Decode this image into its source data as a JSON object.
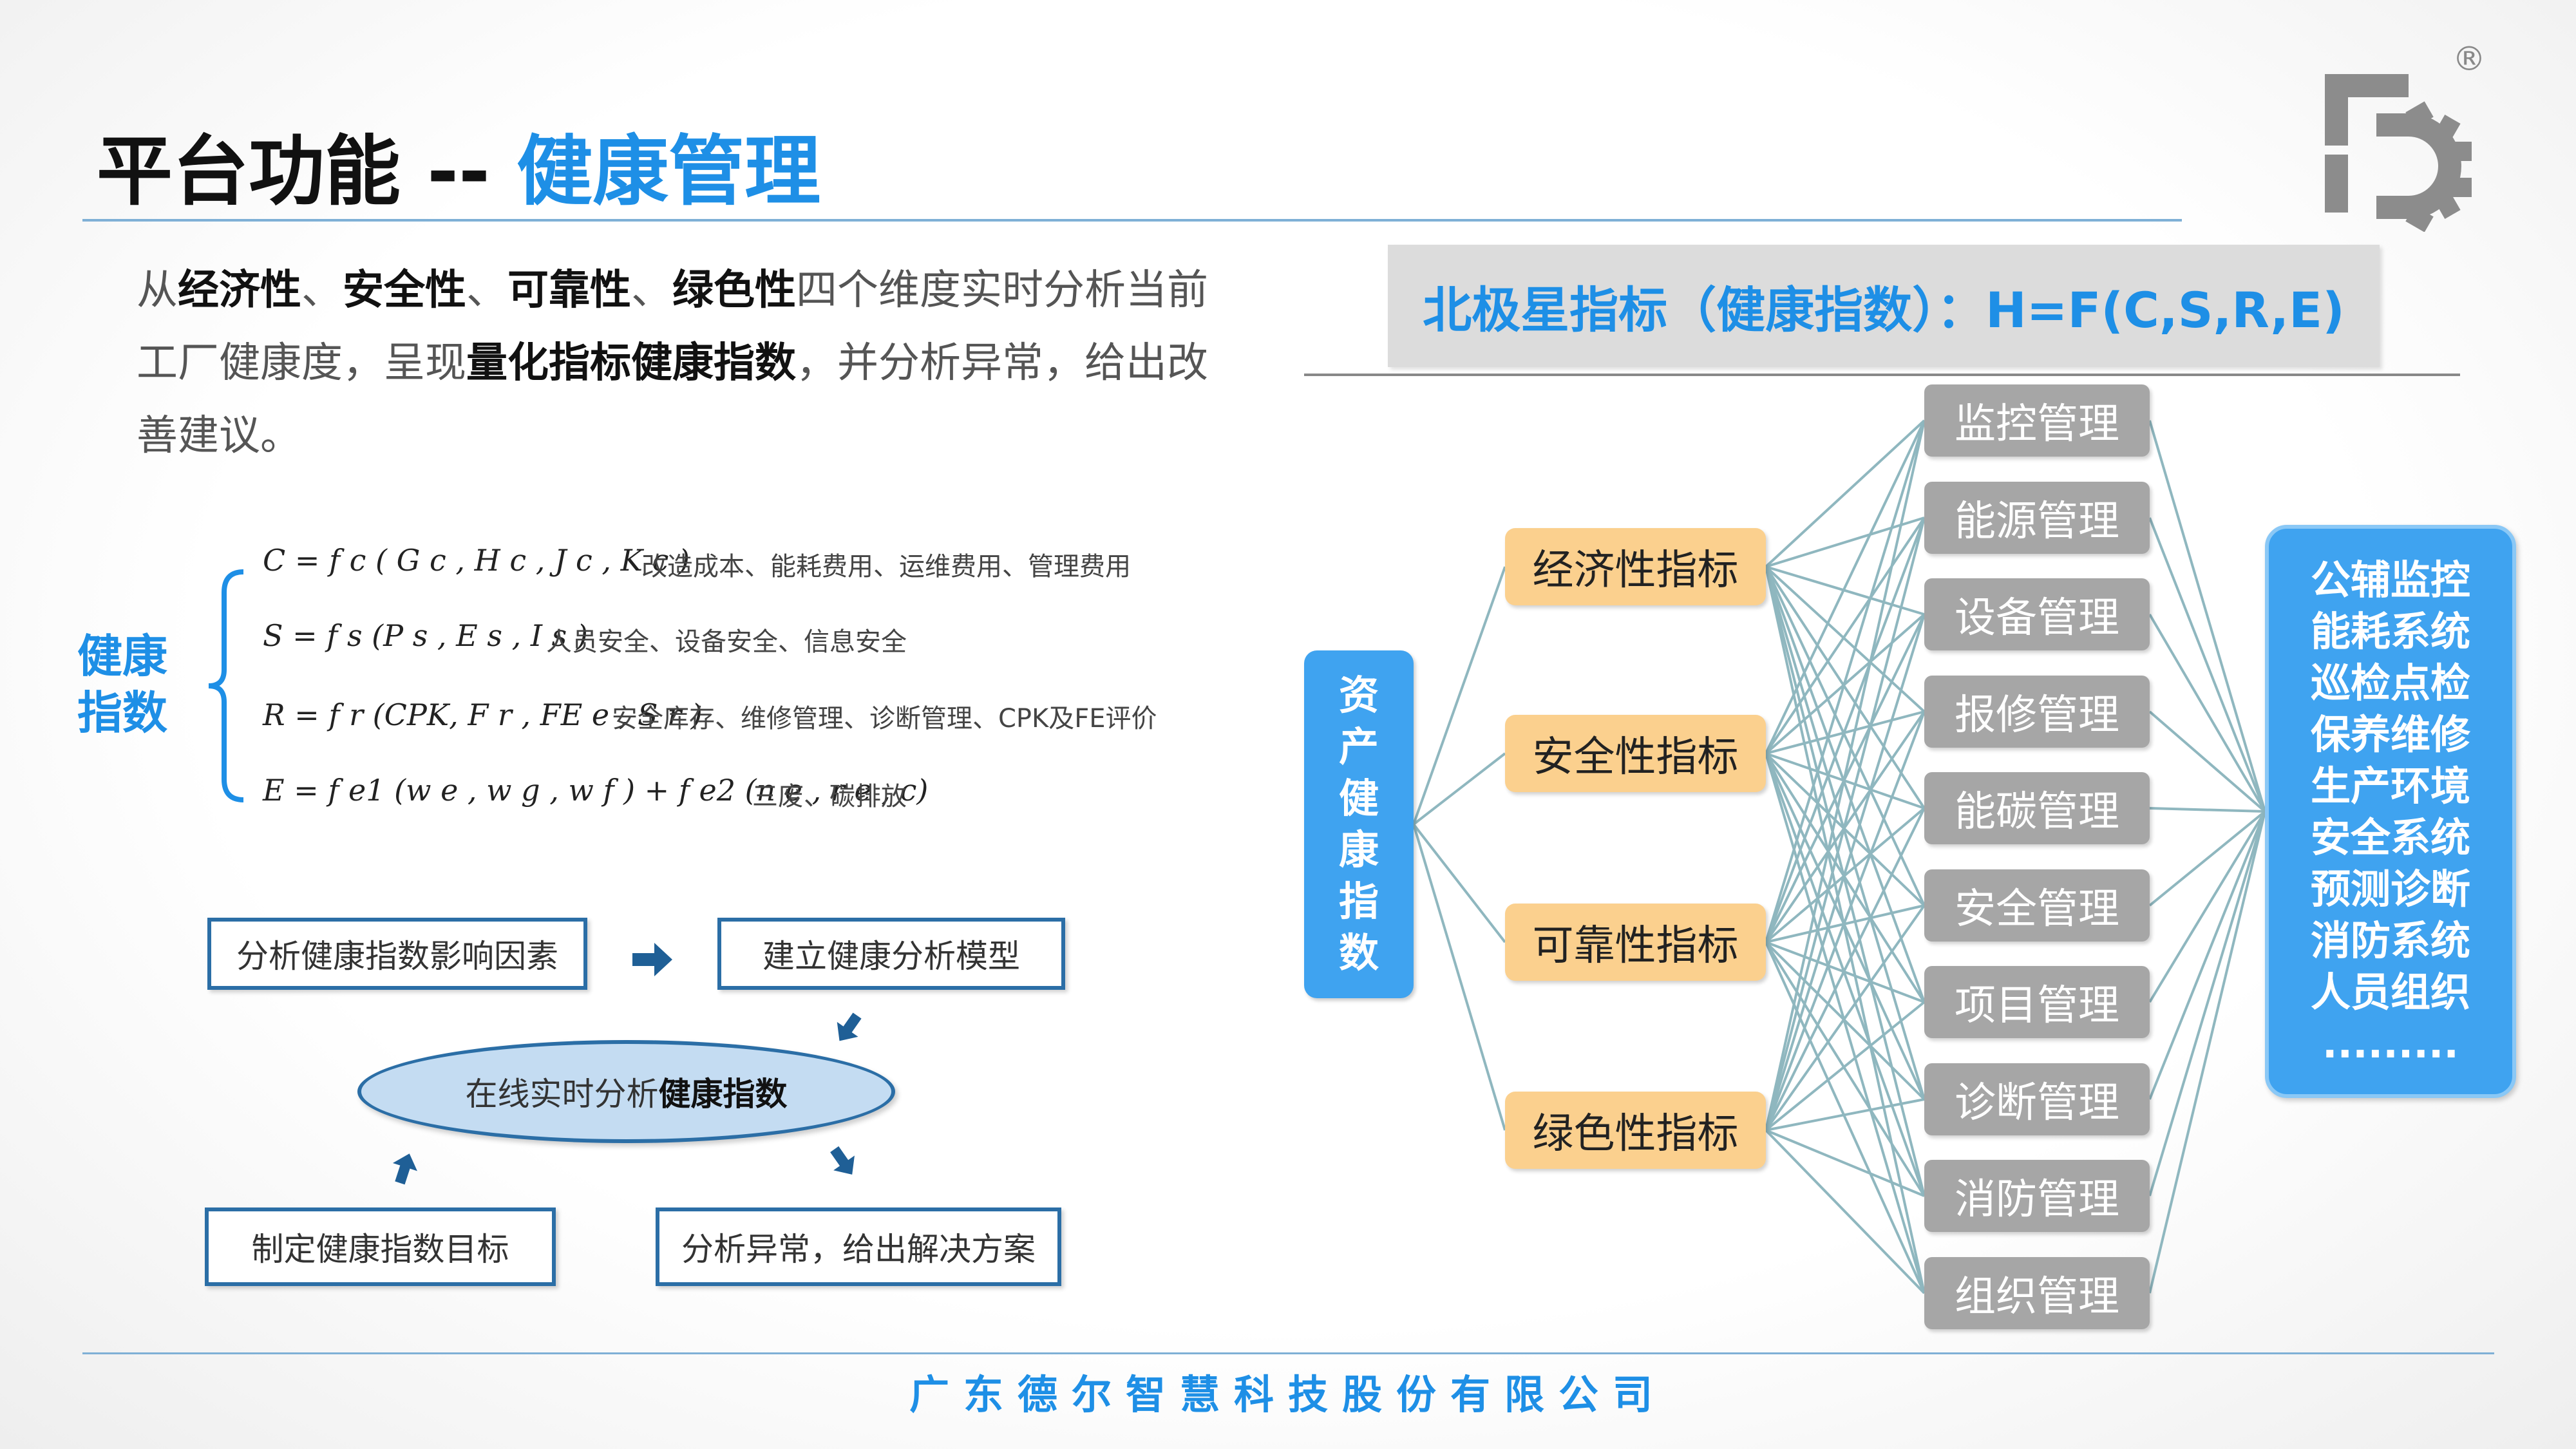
{
  "header": {
    "title_prefix": "平台功能 -- ",
    "title_accent": "健康管理"
  },
  "intro": [
    {
      "text": "从",
      "bold": false
    },
    {
      "text": "经济性",
      "bold": true
    },
    {
      "text": "、",
      "bold": false
    },
    {
      "text": "安全性",
      "bold": true
    },
    {
      "text": "、",
      "bold": false
    },
    {
      "text": "可靠性",
      "bold": true
    },
    {
      "text": "、",
      "bold": false
    },
    {
      "text": "绿色性",
      "bold": true
    },
    {
      "text": "四个维度实时分析当前工厂健康度，呈现",
      "bold": false
    },
    {
      "text": "量化指标健康指数",
      "bold": true
    },
    {
      "text": "，并分析异常，给出改善建议。",
      "bold": false
    }
  ],
  "health_index_label": "健康指数",
  "formulas": [
    {
      "text": "C = f c ( G c , H c , J c , K c )",
      "desc": "改造成本、能耗费用、运维费用、管理费用"
    },
    {
      "text": "S = f s (P s , E s , I s )",
      "desc": "人员安全、设备安全、信息安全"
    },
    {
      "text": "R = f r (CPK, F r , FE e , S r )",
      "desc": "安全库存、维修管理、诊断管理、CPK及FE评价"
    },
    {
      "text": "E = f e1 (w e , w g , w f ) + f e2 (n e , r e , c)",
      "desc": "三废、碳排放"
    }
  ],
  "flow": {
    "factors": "分析健康指数影响因素",
    "model": "建立健康分析模型",
    "online_prefix": "在线实时分析",
    "online_bold": "健康指数",
    "target": "制定健康指数目标",
    "anomaly": "分析异常，给出解决方案"
  },
  "banner": "北极星指标（健康指数）：H=F(C,S,R,E)",
  "asset_label": "资产健康指数",
  "indicators": [
    "经济性指标",
    "安全性指标",
    "可靠性指标",
    "绿色性指标"
  ],
  "management": [
    "监控管理",
    "能源管理",
    "设备管理",
    "报修管理",
    "能碳管理",
    "安全管理",
    "项目管理",
    "诊断管理",
    "消防管理",
    "组织管理"
  ],
  "systems": [
    "公辅监控",
    "能耗系统",
    "巡检点检",
    "保养维修",
    "生产环境",
    "安全系统",
    "预测诊断",
    "消防系统",
    "人员组织",
    "........."
  ],
  "footer": "广东德尔智慧科技股份有限公司",
  "logo": {
    "icon": "gear-logo-icon",
    "mark": "®"
  },
  "colors": {
    "accent": "#1e8fe6",
    "indicator": "#fbd08e",
    "management": "#a6a6a6",
    "connector": "#8fb7bf",
    "flow_border": "#2b6ea6"
  }
}
